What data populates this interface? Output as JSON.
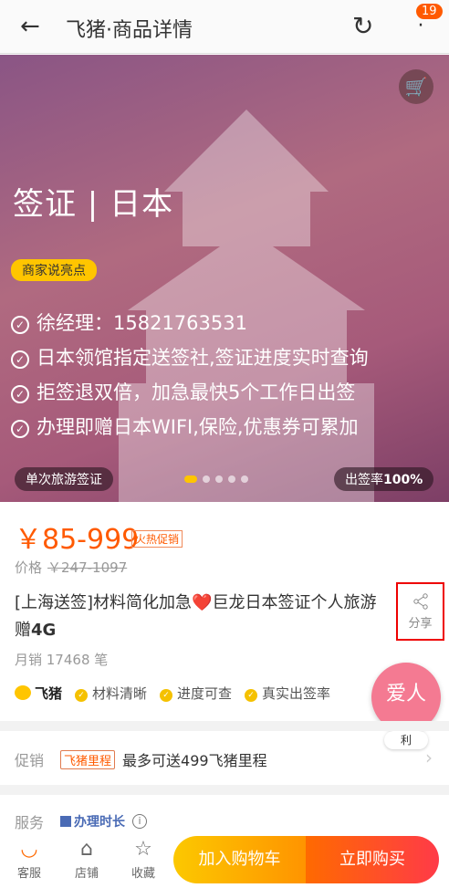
{
  "header": {
    "title": "飞猪·商品详情",
    "badge": "19"
  },
  "banner": {
    "title": "签证 | 日本",
    "highlight_tag": "商家说亮点",
    "bullets": [
      "徐经理：15821763531",
      "日本领馆指定送签社,签证进度实时查询",
      "拒签退双倍，加急最快5个工作日出签",
      "办理即赠日本WIFI,保险,优惠券可累加"
    ],
    "left_pill": "单次旅游签证",
    "right_pill_prefix": "出签率",
    "right_pill_value": "100%",
    "slide_count": 5,
    "active_slide": 1
  },
  "product": {
    "price": "￥85-999",
    "hot_tag": "火热促销",
    "orig_label": "价格",
    "orig_price": "￥247-1097",
    "name_part1": "[上海送签]材料简化加急",
    "heart": "❤️",
    "name_part2": "巨龙日本签证个人旅游赠",
    "name_bold": "4G",
    "share": "分享",
    "sales": "月销 17468 笔"
  },
  "features": {
    "logo": "飞猪",
    "items": [
      "材料清晰",
      "进度可查",
      "真实出签率"
    ]
  },
  "float": {
    "label": "爱人",
    "tag": "利"
  },
  "promo": {
    "label": "促销",
    "tag": "飞猪里程",
    "text": "最多可送499飞猪里程"
  },
  "service": {
    "label": "服务",
    "tag": "办理时长",
    "info": "i"
  },
  "bottom": {
    "service": "客服",
    "shop": "店铺",
    "fav": "收藏",
    "add_cart": "加入购物车",
    "buy_now": "立即购买"
  }
}
